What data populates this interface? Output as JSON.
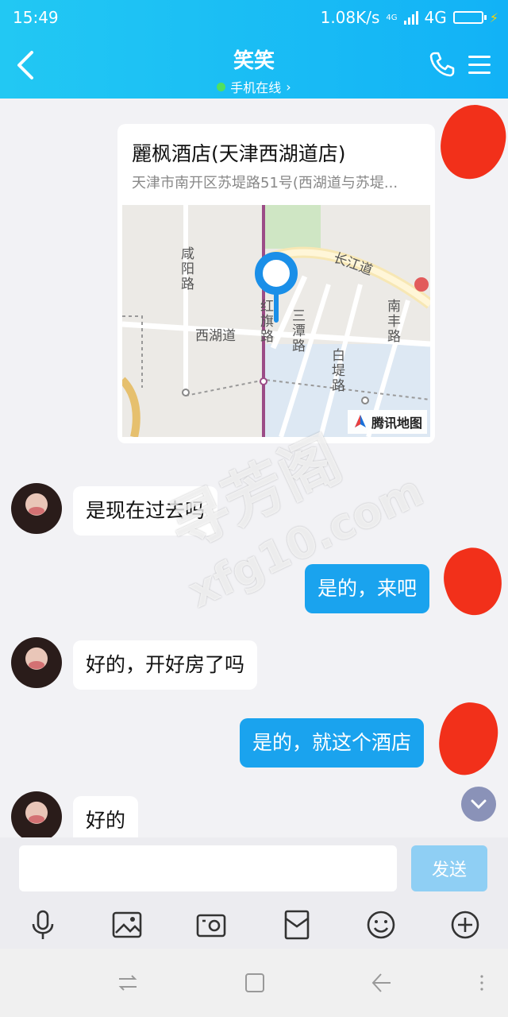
{
  "status_bar": {
    "time": "15:49",
    "speed": "1.08K/s",
    "network": "4G",
    "network_small": "4G"
  },
  "header": {
    "contact_name": "笑笑",
    "presence": "手机在线",
    "presence_chevron": "›"
  },
  "location_card": {
    "name": "麗枫酒店(天津西湖道店)",
    "address": "天津市南开区苏堤路51号(西湖道与苏堤...",
    "map_labels": {
      "xianyang_road": "咸阳路",
      "changjiang_road": "长江道",
      "nanfeng_road": "南丰路",
      "xihu_road": "西湖道",
      "hongqi_road": "红旗路",
      "santan_road": "三潭路",
      "baiti_road": "白堤路"
    },
    "provider": "腾讯地图"
  },
  "messages": [
    {
      "side": "in",
      "text": "是现在过去吗"
    },
    {
      "side": "out",
      "text": "是的，来吧"
    },
    {
      "side": "in",
      "text": "好的，开好房了吗"
    },
    {
      "side": "out",
      "text": "是的，就这个酒店"
    },
    {
      "side": "in",
      "text": "好的"
    }
  ],
  "watermark": {
    "line1": "寻芳阁",
    "line2": "xfg10.com"
  },
  "composer": {
    "input_value": "",
    "send_label": "发送"
  },
  "toolbar_icons": [
    "microphone-icon",
    "image-icon",
    "camera-icon",
    "red-packet-icon",
    "emoji-icon",
    "plus-icon"
  ],
  "colors": {
    "header": "#1ab6f5",
    "outgoing_bubble": "#1aa3ee",
    "send_button": "#8fcff4"
  }
}
